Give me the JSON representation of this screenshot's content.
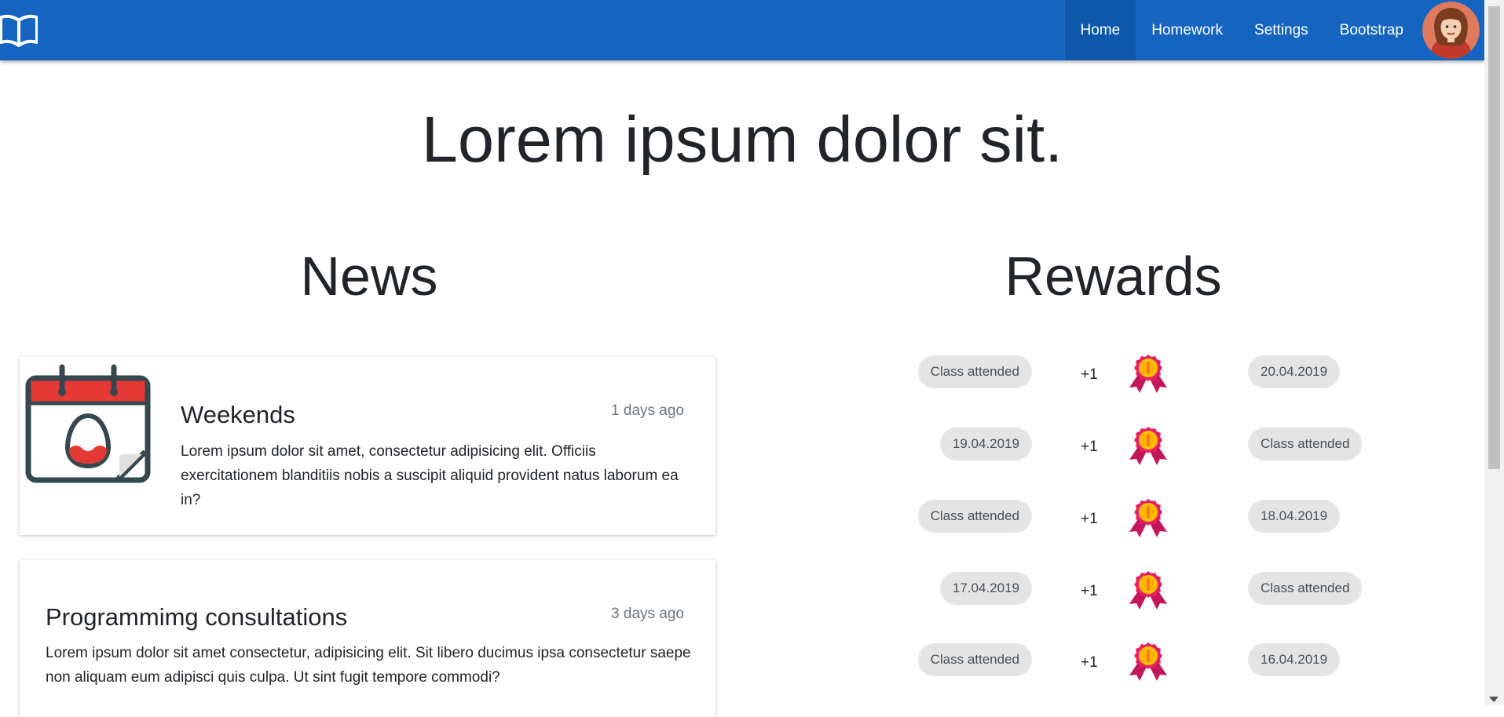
{
  "navbar": {
    "brand_icon": "open-book-icon",
    "items": [
      {
        "label": "Home",
        "active": true
      },
      {
        "label": "Homework",
        "active": false
      },
      {
        "label": "Settings",
        "active": false
      },
      {
        "label": "Bootstrap",
        "active": false
      }
    ],
    "avatar_icon": "user-avatar",
    "color": "#1565c0"
  },
  "hero": {
    "title": "Lorem ipsum dolor sit."
  },
  "news": {
    "title": "News",
    "cards": [
      {
        "icon": "calendar-easter-egg-icon",
        "title": "Weekends",
        "time": "1 days ago",
        "text": "Lorem ipsum dolor sit amet, consectetur adipisicing elit. Officiis exercitationem blanditiis nobis a suscipit aliquid provident natus laborum ea in?"
      },
      {
        "title": "Programmimg consultations",
        "time": "3 days ago",
        "text": "Lorem ipsum dolor sit amet consectetur, adipisicing elit. Sit libero ducimus ipsa consectetur saepe non aliquam eum adipisci quis culpa. Ut sint fugit tempore commodi?"
      }
    ]
  },
  "rewards": {
    "title": "Rewards",
    "medal_icon": "medal-icon",
    "items": [
      {
        "left": "Class attended",
        "points": "+1",
        "right": "20.04.2019"
      },
      {
        "left": "19.04.2019",
        "points": "+1",
        "right": "Class attended"
      },
      {
        "left": "Class attended",
        "points": "+1",
        "right": "18.04.2019"
      },
      {
        "left": "17.04.2019",
        "points": "+1",
        "right": "Class attended"
      },
      {
        "left": "Class attended",
        "points": "+1",
        "right": "16.04.2019"
      }
    ]
  }
}
